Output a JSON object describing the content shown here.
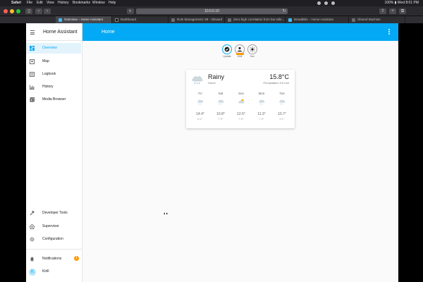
{
  "menubar": {
    "apple": "",
    "items": [
      "Safari",
      "File",
      "Edit",
      "View",
      "History",
      "Bookmarks",
      "Window",
      "Help"
    ],
    "status": "100% ▮ Wed 8:01 PM"
  },
  "browser": {
    "url": "10.0.0.10",
    "tabs": [
      {
        "title": "Overview – Home Assistant",
        "active": true,
        "icon": "home-assistant-icon"
      },
      {
        "title": "Dashboard",
        "active": false,
        "icon": "github-icon"
      },
      {
        "title": "Role Management: 98 – Bitward",
        "active": false,
        "icon": "page-icon"
      },
      {
        "title": "Zero-high correlation from bar.stile...",
        "active": false,
        "icon": "page-icon"
      },
      {
        "title": "BreadBits – Home Assistant",
        "active": false,
        "icon": "home-assistant-icon"
      },
      {
        "title": "Shared Machine",
        "active": false,
        "icon": "page-icon"
      }
    ]
  },
  "sidebar": {
    "title": "Home Assistant",
    "items": [
      {
        "label": "Overview",
        "icon": "view-dashboard-icon",
        "active": true
      },
      {
        "label": "Map",
        "icon": "map-icon",
        "active": false
      },
      {
        "label": "Logbook",
        "icon": "logbook-icon",
        "active": false
      },
      {
        "label": "History",
        "icon": "history-chart-icon",
        "active": false
      },
      {
        "label": "Media Browser",
        "icon": "media-browser-icon",
        "active": false
      }
    ],
    "bottom": [
      {
        "label": "Developer Tools",
        "icon": "hammer-icon"
      },
      {
        "label": "Supervisor",
        "icon": "supervisor-icon"
      },
      {
        "label": "Configuration",
        "icon": "cog-icon"
      }
    ],
    "notifications": {
      "label": "Notifications",
      "count": "1"
    },
    "user": {
      "name": "Kirill",
      "initial": "K"
    }
  },
  "header": {
    "title": "Home"
  },
  "badges": [
    {
      "label": "Update",
      "icon": "update-check-icon"
    },
    {
      "label": "Kirill",
      "icon": "person-icon"
    },
    {
      "label": "Sun",
      "icon": "sun-icon"
    }
  ],
  "weather": {
    "condition": "Rainy",
    "location": "Home",
    "temperature": "15.8°C",
    "precipitation": "Precipitation 3.5 mm",
    "forecast": [
      {
        "day": "Fri",
        "high": "14.4°",
        "low": "6.1°",
        "icon": "rainy-icon"
      },
      {
        "day": "Sat",
        "high": "10.8°",
        "low": "7.9°",
        "icon": "rainy-icon"
      },
      {
        "day": "Sun",
        "high": "12.5°",
        "low": "7.6°",
        "icon": "partly-cloudy-icon"
      },
      {
        "day": "Mon",
        "high": "11.3°",
        "low": "7.4°",
        "icon": "rainy-icon"
      },
      {
        "day": "Tue",
        "high": "10.7°",
        "low": "9.1°",
        "icon": "rainy-icon"
      }
    ]
  },
  "colors": {
    "primary": "#03a9f4",
    "badge": "#ff9800"
  }
}
